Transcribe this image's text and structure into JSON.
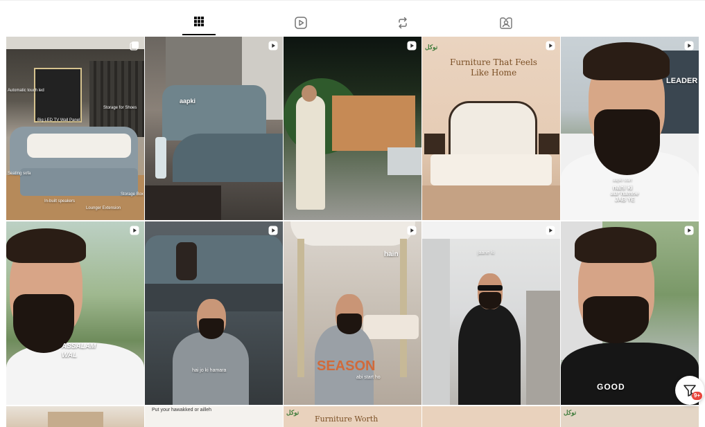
{
  "tabs": [
    {
      "icon": "grid-icon",
      "active": true
    },
    {
      "icon": "reels-icon",
      "active": false
    },
    {
      "icon": "repost-icon",
      "active": false
    },
    {
      "icon": "tagged-icon",
      "active": false
    }
  ],
  "posts": [
    {
      "type": "carousel",
      "captions": [
        "Automatic touch led",
        "Big LED TV Wall Panel",
        "Storage for Shoes",
        "Seating sofa",
        "In-built speakers",
        "Lounger Extension",
        "Storage Box"
      ]
    },
    {
      "type": "reel",
      "captions": [
        "aapki"
      ]
    },
    {
      "type": "reel",
      "captions": []
    },
    {
      "type": "reel",
      "captions": [
        "Furniture That Feels",
        "Like Home"
      ]
    },
    {
      "type": "reel",
      "captions": [
        "LEADER",
        "aapki start",
        "nahi ki",
        "aur hamne",
        "JAB YE"
      ]
    },
    {
      "type": "reel",
      "captions": [
        "ASSALAM",
        "WAL"
      ]
    },
    {
      "type": "reel",
      "captions": [
        "hai jo ki hamara"
      ]
    },
    {
      "type": "reel",
      "captions": [
        "hain",
        "SEASON",
        "abi start ho"
      ]
    },
    {
      "type": "reel",
      "captions": [
        "jaane ki"
      ]
    },
    {
      "type": "reel",
      "captions": [
        "GOOD"
      ]
    },
    {
      "type": "carousel",
      "captions": []
    },
    {
      "type": "carousel",
      "captions": [
        "Put your hawakked or ailleh"
      ]
    },
    {
      "type": "carousel",
      "captions": [
        "Furniture Worth"
      ]
    },
    {
      "type": "carousel",
      "captions": []
    },
    {
      "type": "carousel",
      "captions": []
    }
  ],
  "filter_badge": "9+",
  "colors": {
    "accent_badge": "#e8453c",
    "tab_active": "#000000",
    "tab_inactive": "#737373"
  }
}
